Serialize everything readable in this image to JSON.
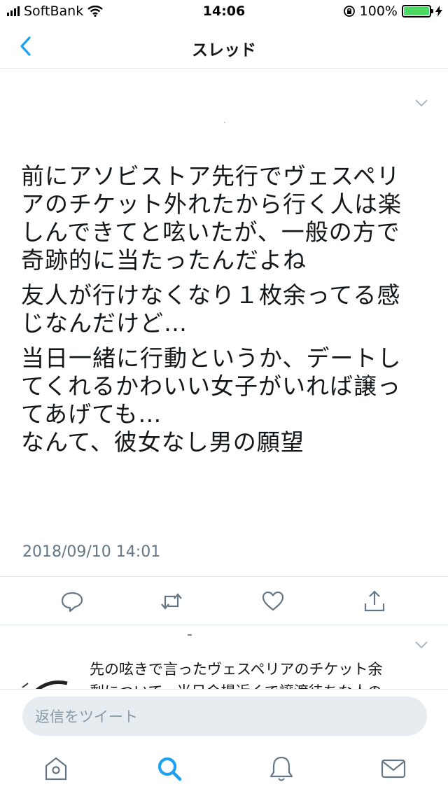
{
  "status_bar": {
    "carrier": "SoftBank",
    "time": "14:06",
    "battery_percent": "100%",
    "battery_level": 1.0
  },
  "nav": {
    "title": "スレッド"
  },
  "tweet": {
    "paragraphs": [
      [
        "前にアソビストア先行でヴェスペリ",
        "アのチケット外れたから行く人は楽",
        "しんできてと呟いたが、一般の方で",
        "奇跡的に当たったんだよね"
      ],
      [
        "友人が行けなくなり１枚余ってる感",
        "じなんだけど…"
      ],
      [
        "当日一緒に行動というか、デートし",
        "てくれるかわいい女子がいれば譲っ",
        "てあげても…",
        "なんて、彼女なし男の願望"
      ]
    ],
    "timestamp": "2018/09/10 14:01"
  },
  "actions": [
    "reply-icon",
    "retweet-icon",
    "like-icon",
    "share-icon"
  ],
  "reply_preview": {
    "lines": [
      "先の呟きで言ったヴェスペリアのチケット余",
      "剰について、当日会場近くで譲渡待ちな人の"
    ]
  },
  "compose": {
    "placeholder": "返信をツイート"
  },
  "tabs": [
    "home-icon",
    "search-icon",
    "notifications-icon",
    "messages-icon"
  ],
  "colors": {
    "accent": "#1da1f2",
    "icon_gray": "#657786",
    "text": "#14171a",
    "battery": "#4cd964"
  }
}
